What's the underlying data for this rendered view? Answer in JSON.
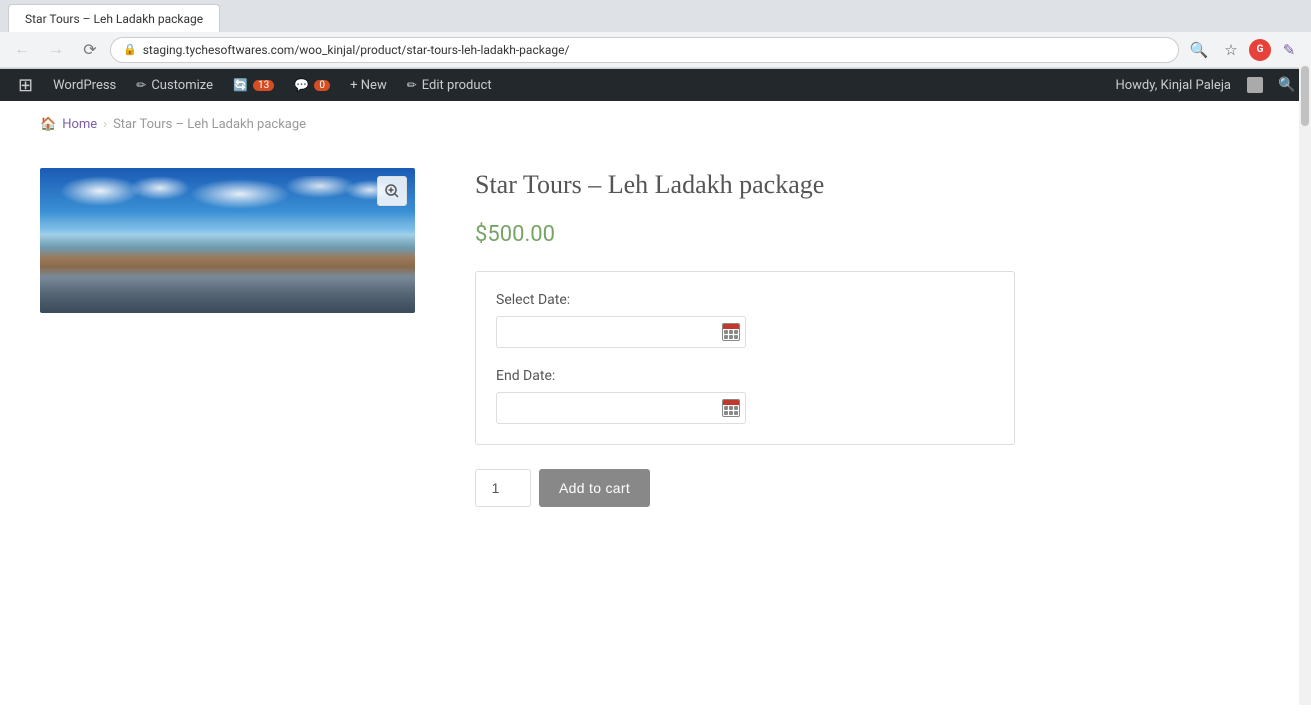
{
  "browser": {
    "url": "staging.tychesoftwares.com/woo_kinjal/product/star-tours-leh-ladakh-package/",
    "url_display": "staging.tychesoftwares.com/woo_kinjal/product/star-tours-leh-ladakh-package/",
    "tab_title": "Star Tours – Leh Ladakh package",
    "back_disabled": true,
    "forward_disabled": true
  },
  "wp_admin_bar": {
    "wp_logo": "W",
    "items": [
      {
        "id": "wordpress",
        "label": "WordPress",
        "icon": "wp"
      },
      {
        "id": "customize",
        "label": "Customize",
        "icon": "pencil"
      },
      {
        "id": "updates",
        "label": "13",
        "icon": "updates"
      },
      {
        "id": "comments",
        "label": "0",
        "icon": "comments"
      },
      {
        "id": "new",
        "label": "+ New",
        "icon": "new"
      },
      {
        "id": "edit",
        "label": "Edit product",
        "icon": "pencil"
      }
    ],
    "howdy": "Howdy, Kinjal Paleja",
    "search_placeholder": "Search"
  },
  "breadcrumb": {
    "home_label": "Home",
    "separator": "›",
    "current": "Star Tours – Leh Ladakh package"
  },
  "product": {
    "title": "Star Tours – Leh Ladakh package",
    "price": "$500.00",
    "select_date_label": "Select Date:",
    "end_date_label": "End Date:",
    "quantity_value": "1",
    "add_to_cart_label": "Add to cart"
  }
}
